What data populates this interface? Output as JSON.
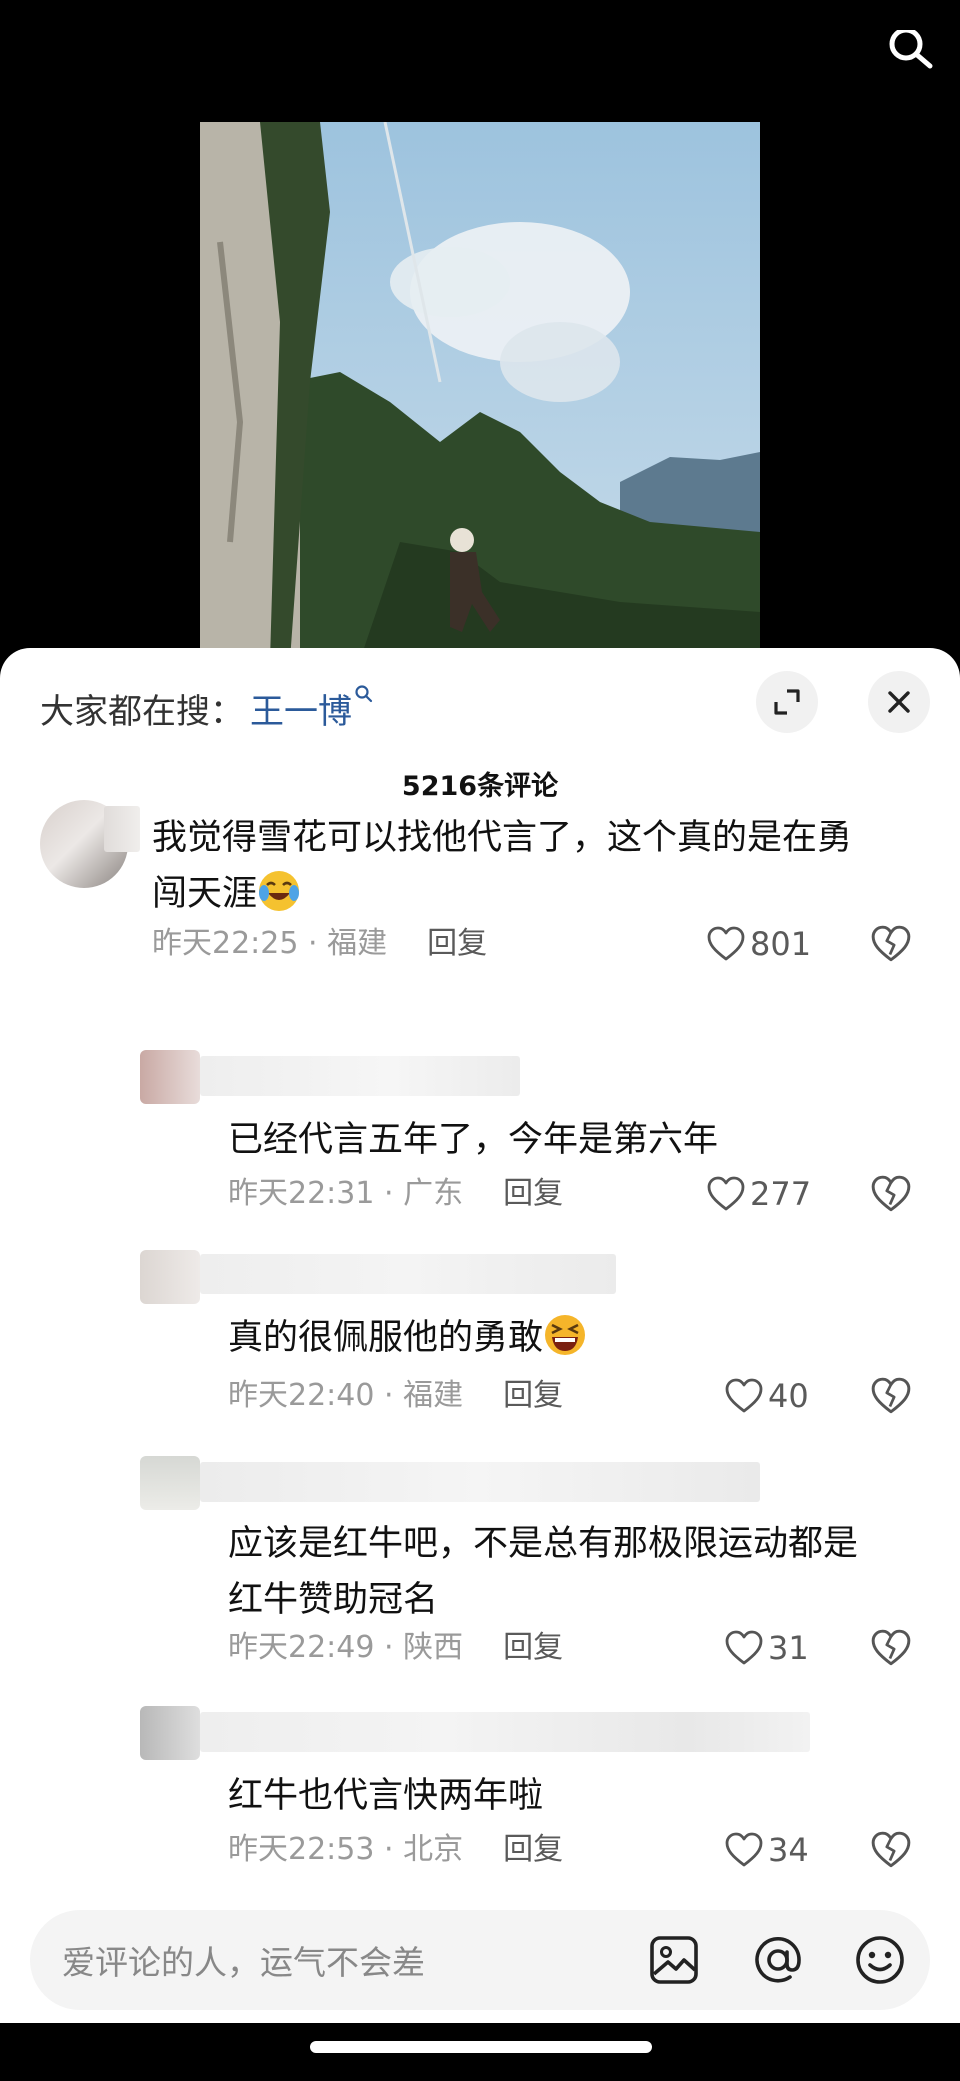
{
  "hot_search": {
    "label": "大家都在搜：",
    "keyword": "王一博"
  },
  "comment_count": "5216条评论",
  "comments": [
    {
      "text": "我觉得雪花可以找他代言了，这个真的是在勇闯天涯",
      "text_line1": "我觉得雪花可以找他代言了，这个真的是在勇",
      "text_line2": "闯天涯",
      "emoji": "laugh-cry-emoji",
      "time": "昨天22:25",
      "location": "福建",
      "reply": "回复",
      "likes": "801"
    },
    {
      "text": "已经代言五年了，今年是第六年",
      "time": "昨天22:31",
      "location": "广东",
      "reply": "回复",
      "likes": "277"
    },
    {
      "text": "真的很佩服他的勇敢",
      "emoji": "grin-squint-emoji",
      "time": "昨天22:40",
      "location": "福建",
      "reply": "回复",
      "likes": "40"
    },
    {
      "text": "应该是红牛吧，不是总有那极限运动都是红牛赞助冠名",
      "text_line1": "应该是红牛吧，不是总有那极限运动都是",
      "text_line2": "红牛赞助冠名",
      "time": "昨天22:49",
      "location": "陕西",
      "reply": "回复",
      "likes": "31"
    },
    {
      "text": "红牛也代言快两年啦",
      "time": "昨天22:53",
      "location": "北京",
      "reply": "回复",
      "likes": "34"
    }
  ],
  "input": {
    "placeholder": "爱评论的人，运气不会差"
  },
  "colors": {
    "keyword": "#2b5a9a",
    "meta": "#9a9a9a",
    "sheet_bg": "#ffffff"
  },
  "icons": [
    "search-icon",
    "expand-icon",
    "close-icon",
    "heart-icon",
    "heart-broken-icon",
    "image-icon",
    "at-icon",
    "smiley-icon"
  ]
}
